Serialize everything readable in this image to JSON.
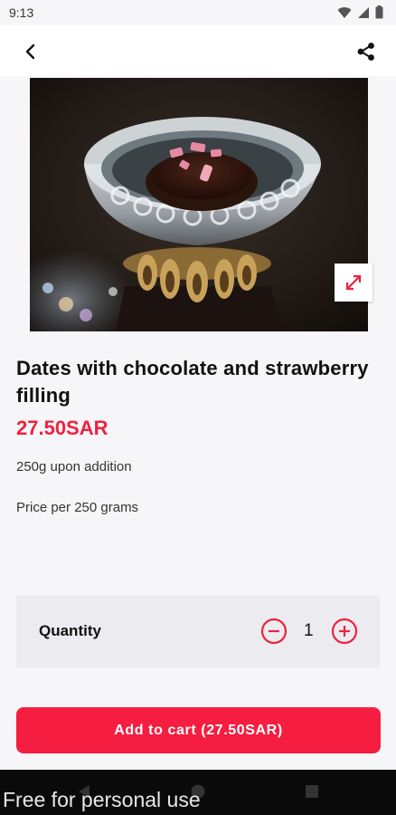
{
  "status_bar": {
    "time": "9:13"
  },
  "product": {
    "title": "Dates with chocolate and strawberry filling",
    "price": "27.50SAR",
    "description_1": "250g upon addition",
    "description_2": "Price per 250 grams"
  },
  "quantity": {
    "label": "Quantity",
    "value": "1"
  },
  "cart_button": {
    "label": "Add to cart (27.50SAR)"
  },
  "watermark": "Free for personal use",
  "colors": {
    "accent": "#f51d40",
    "price": "#f0213f",
    "card_bg": "#ececf0"
  },
  "icons": [
    "back-arrow-icon",
    "share-icon",
    "expand-icon",
    "minus-circle-icon",
    "plus-circle-icon",
    "wifi-icon",
    "signal-icon",
    "battery-icon"
  ]
}
